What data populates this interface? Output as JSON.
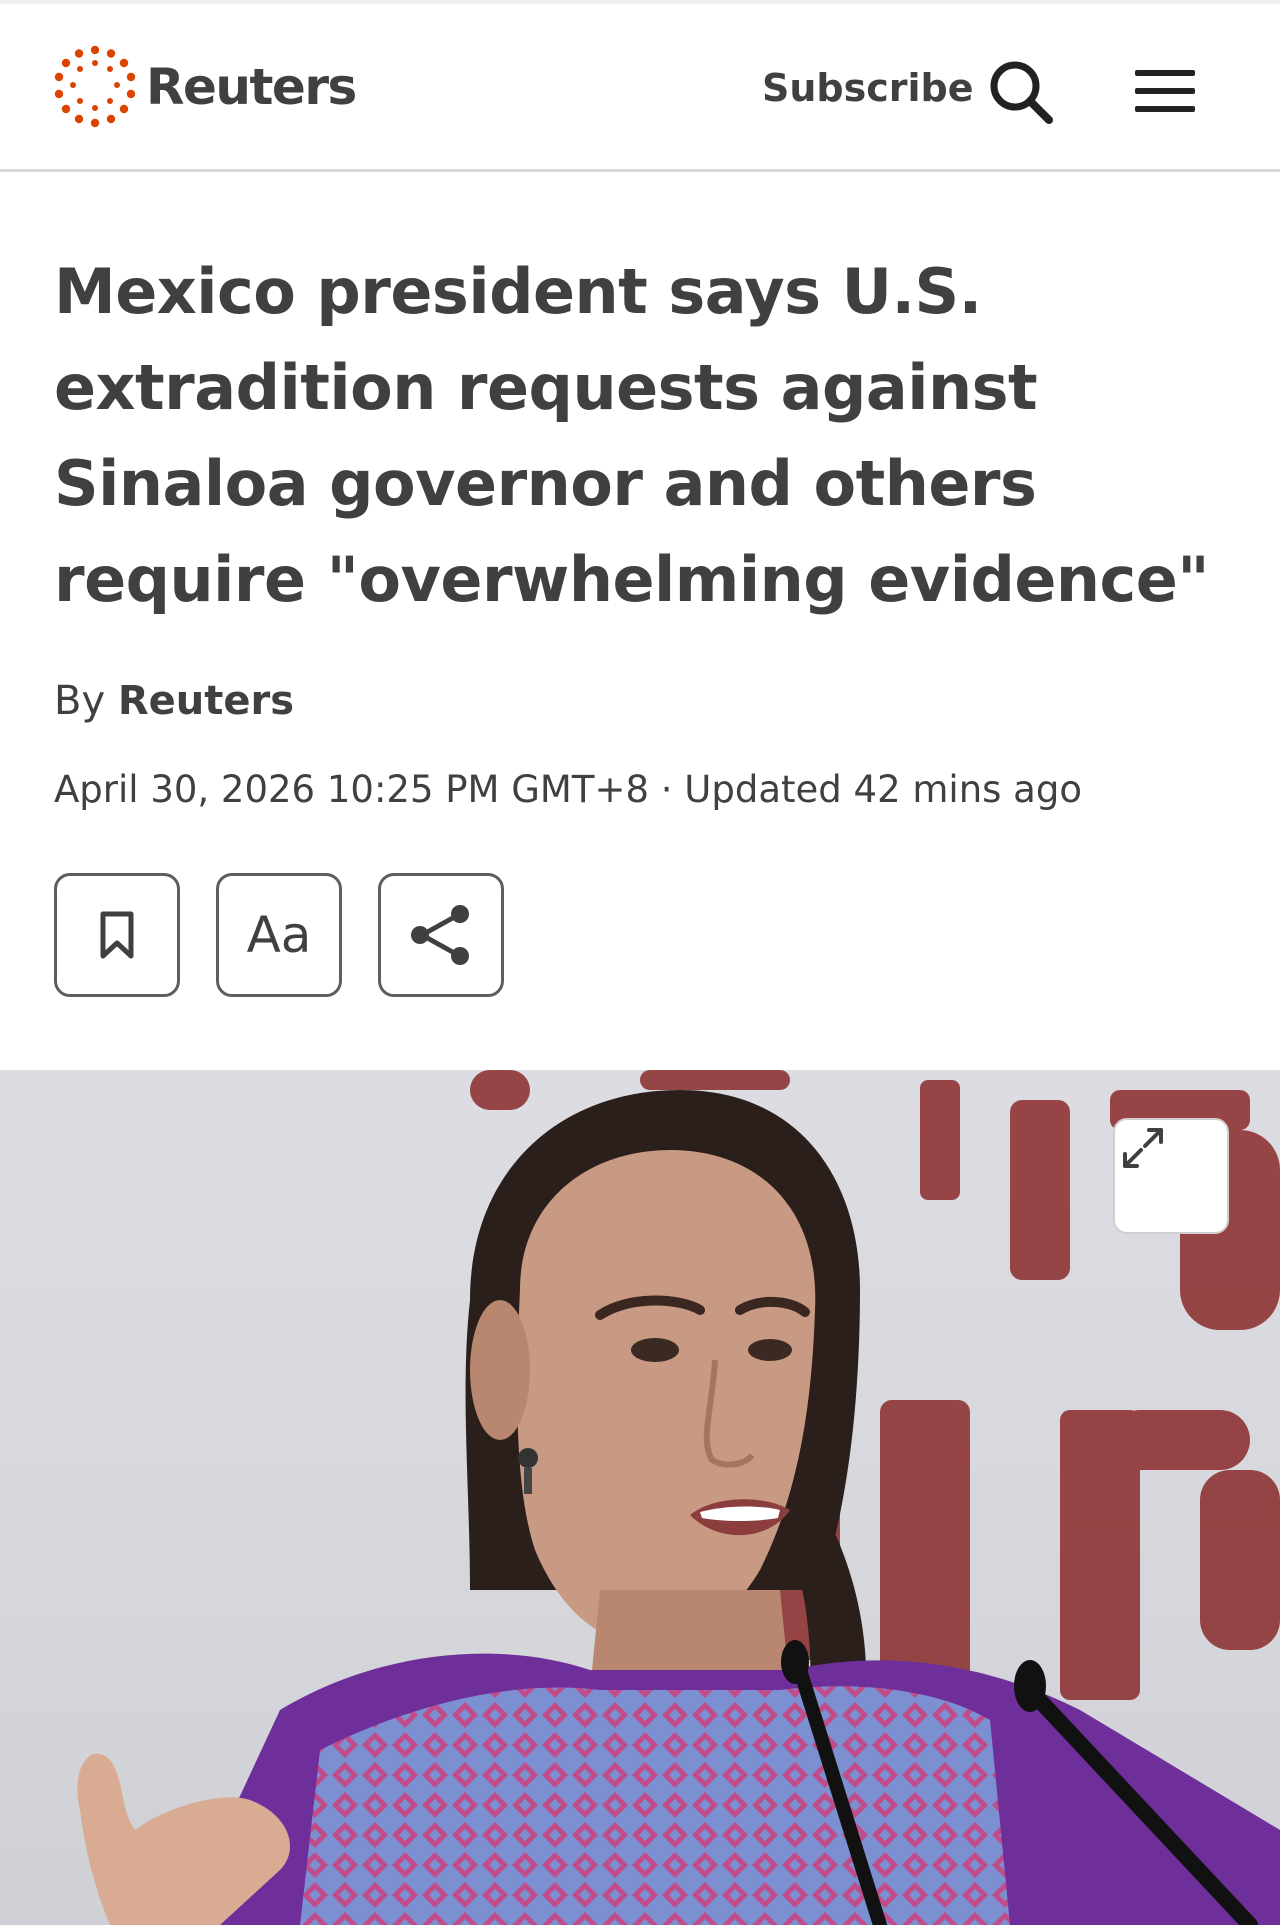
{
  "header": {
    "brand": "Reuters",
    "subscribe_label": "Subscribe",
    "search_icon": "search-icon",
    "menu_icon": "menu-icon",
    "brand_color": "#dc4300"
  },
  "article": {
    "headline": "Mexico president says U.S. extradition requests against Sinaloa governor and others require \"overwhelming evidence\"",
    "byline_prefix": "By",
    "author": "Reuters",
    "date": "April 30, 2026 10:25 PM GMT+8",
    "separator": "·",
    "updated": "Updated 42 mins ago"
  },
  "toolbar": {
    "bookmark_icon": "bookmark-icon",
    "font_label": "Aa",
    "share_icon": "share-icon"
  },
  "photo": {
    "expand_icon": "expand-icon"
  }
}
